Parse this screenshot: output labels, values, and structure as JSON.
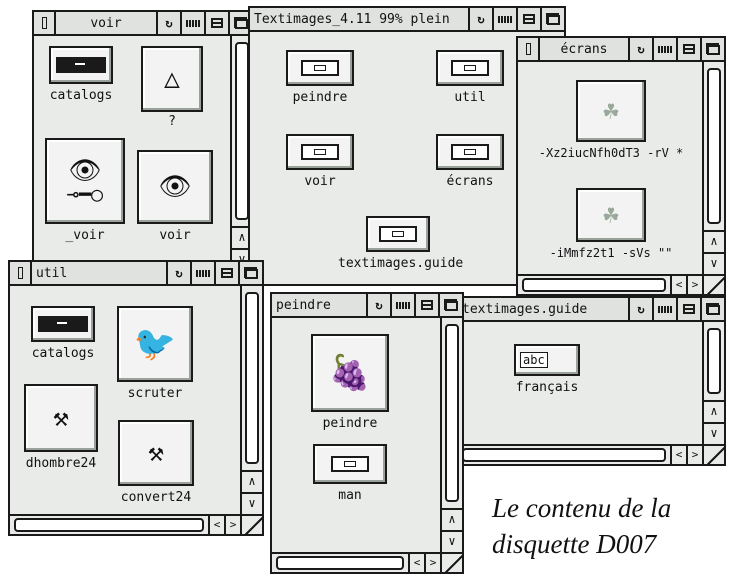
{
  "windows": {
    "voir": {
      "title": "voir",
      "icons": [
        {
          "label": "catalogs",
          "glyph": "drawer-dark"
        },
        {
          "label": "?",
          "glyph": "triangle"
        },
        {
          "label": "_voir",
          "glyph": "eye-key"
        },
        {
          "label": "voir",
          "glyph": "eye"
        }
      ]
    },
    "textimages": {
      "title": "Textimages_4.11  99% plein",
      "icons": [
        {
          "label": "peindre",
          "glyph": "drawer"
        },
        {
          "label": "util",
          "glyph": "drawer"
        },
        {
          "label": "voir",
          "glyph": "drawer"
        },
        {
          "label": "écrans",
          "glyph": "drawer"
        },
        {
          "label": "textimages.guide",
          "glyph": "drawer"
        }
      ]
    },
    "ecrans": {
      "title": "écrans",
      "icons": [
        {
          "label": "-Xz2iucNfh0dT3 -rV *",
          "glyph": "clover"
        },
        {
          "label": "-iMmfz2t1 -sVs \"\"",
          "glyph": "clover"
        }
      ]
    },
    "util": {
      "title": "util",
      "icons": [
        {
          "label": "catalogs",
          "glyph": "drawer-dark"
        },
        {
          "label": "scruter",
          "glyph": "bird"
        },
        {
          "label": "dhombre24",
          "glyph": "hammer"
        },
        {
          "label": "convert24",
          "glyph": "hammer"
        }
      ]
    },
    "peindre": {
      "title": "peindre",
      "icons": [
        {
          "label": "peindre",
          "glyph": "grapes"
        },
        {
          "label": "man",
          "glyph": "drawer"
        }
      ]
    },
    "guide": {
      "title": "textimages.guide",
      "icons": [
        {
          "label": "français",
          "glyph": "abc",
          "text": "abc"
        }
      ]
    }
  },
  "caption": {
    "line1": "Le contenu de la",
    "line2": "disquette D007"
  },
  "colors": {
    "window_bg": "#e9ebe9",
    "border": "#1a1a1a",
    "page_bg": "#ffffff"
  }
}
